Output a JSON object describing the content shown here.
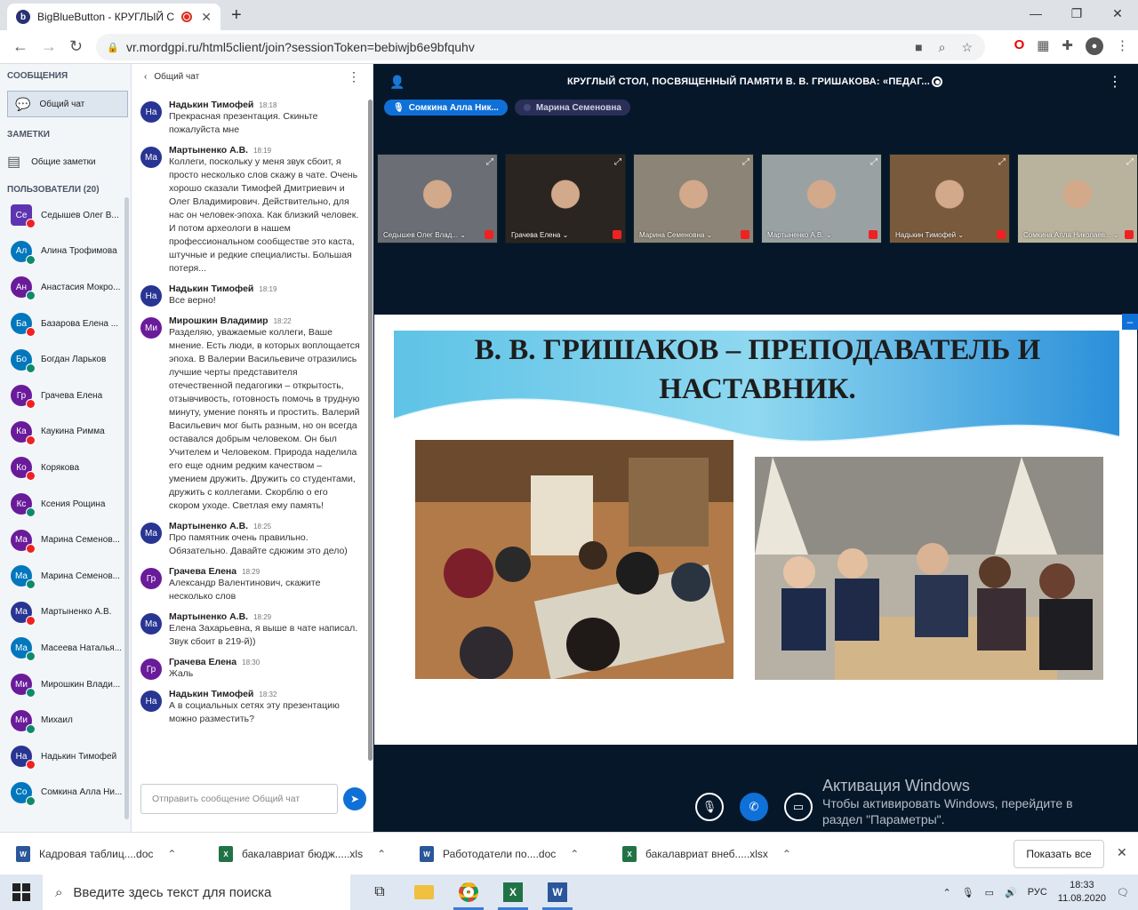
{
  "browser": {
    "tab_title": "BigBlueButton - КРУГЛЫЙ С",
    "tab_favicon": "b",
    "new_tab": "+",
    "url": "vr.mordgpi.ru/html5client/join?sessionToken=bebiwjb6e9bfquhv",
    "window_controls": [
      "—",
      "❐",
      "✕"
    ]
  },
  "user_panel": {
    "messages_heading": "СООБЩЕНИЯ",
    "public_chat": "Общий чат",
    "notes_heading": "ЗАМЕТКИ",
    "shared_notes": "Общие заметки",
    "users_heading": "ПОЛЬЗОВАТЕЛИ (20)",
    "users": [
      {
        "initials": "Се",
        "name": "Седышев Олег В...",
        "color": "#5e35b1",
        "mic": "muted",
        "square": true
      },
      {
        "initials": "Ал",
        "name": "Алина Трофимова",
        "color": "#0277bd",
        "mic": "listen"
      },
      {
        "initials": "Ан",
        "name": "Анастасия Мокро...",
        "color": "#6a1b9a",
        "mic": "listen"
      },
      {
        "initials": "Ба",
        "name": "Базарова Елена ...",
        "color": "#0277bd",
        "mic": "muted"
      },
      {
        "initials": "Бо",
        "name": "Богдан Ларьков",
        "color": "#0277bd",
        "mic": "listen"
      },
      {
        "initials": "Гр",
        "name": "Грачева Елена",
        "color": "#6a1b9a",
        "mic": "muted"
      },
      {
        "initials": "Ка",
        "name": "Каукина Римма",
        "color": "#6a1b9a",
        "mic": "muted"
      },
      {
        "initials": "Ко",
        "name": "Корякова",
        "color": "#6a1b9a",
        "mic": "muted"
      },
      {
        "initials": "Кс",
        "name": "Ксения Рощина",
        "color": "#6a1b9a",
        "mic": "listen"
      },
      {
        "initials": "Ма",
        "name": "Марина Семенов...",
        "color": "#6a1b9a",
        "mic": "muted"
      },
      {
        "initials": "Ма",
        "name": "Марина Семенов...",
        "color": "#0277bd",
        "mic": "listen"
      },
      {
        "initials": "Ма",
        "name": "Мартыненко А.В.",
        "color": "#283593",
        "mic": "muted"
      },
      {
        "initials": "Ма",
        "name": "Масеева Наталья...",
        "color": "#0277bd",
        "mic": "listen"
      },
      {
        "initials": "Ми",
        "name": "Мирошкин Влади...",
        "color": "#6a1b9a",
        "mic": "listen"
      },
      {
        "initials": "Ми",
        "name": "Михаил",
        "color": "#6a1b9a",
        "mic": "listen"
      },
      {
        "initials": "На",
        "name": "Надькин Тимофей",
        "color": "#283593",
        "mic": "muted"
      },
      {
        "initials": "Со",
        "name": "Сомкина Алла Ни...",
        "color": "#0277bd",
        "mic": "listen"
      }
    ]
  },
  "chat": {
    "back_label": "Общий чат",
    "messages": [
      {
        "initials": "На",
        "color": "#283593",
        "name": "Надькин Тимофей",
        "time": "18:18",
        "text": "Прекрасная презентация. Скиньте пожалуйста мне"
      },
      {
        "initials": "Ма",
        "color": "#283593",
        "name": "Мартыненко А.В.",
        "time": "18:19",
        "text": "Коллеги, поскольку у меня звук сбоит, я просто несколько слов скажу в чате. Очень хорошо сказали Тимофей Дмитриевич и Олег Владимирович. Действительно, для нас он человек-эпоха. Как близкий человек. И потом археологи в нашем профессиональном сообществе это каста, штучные и редкие специалисты. Большая потеря..."
      },
      {
        "initials": "На",
        "color": "#283593",
        "name": "Надькин Тимофей",
        "time": "18:19",
        "text": "Все верно!"
      },
      {
        "initials": "Ми",
        "color": "#6a1b9a",
        "name": "Мирошкин Владимир",
        "time": "18:22",
        "text": "Разделяю, уважаемые коллеги, Ваше мнение. Есть люди, в которых воплощается эпоха. В Валерии Васильевиче отразились лучшие черты представителя отечественной педагогики – открытость, отзывчивость, готовность помочь в трудную минуту, умение понять и простить. Валерий Васильевич мог быть разным, но он всегда оставался добрым человеком. Он был Учителем и Человеком. Природа наделила его еще одним редким качеством – умением дружить. Дружить со студентами, дружить с коллегами. Скорблю о его скором уходе. Светлая ему память!"
      },
      {
        "initials": "Ма",
        "color": "#283593",
        "name": "Мартыненко А.В.",
        "time": "18:25",
        "text": "Про памятник очень правильно. Обязательно. Давайте сдюжим это дело)"
      },
      {
        "initials": "Гр",
        "color": "#6a1b9a",
        "name": "Грачева Елена",
        "time": "18:29",
        "text": "Александр Валентинович, скажите несколько слов"
      },
      {
        "initials": "Ма",
        "color": "#283593",
        "name": "Мартыненко А.В.",
        "time": "18:29",
        "text": "Елена Захарьевна, я выше в чате написал. Звук сбоит в 219-й))"
      },
      {
        "initials": "Гр",
        "color": "#6a1b9a",
        "name": "Грачева Елена",
        "time": "18:30",
        "text": "Жаль"
      },
      {
        "initials": "На",
        "color": "#283593",
        "name": "Надькин Тимофей",
        "time": "18:32",
        "text": "А в социальных сетях эту презентацию можно разместить?"
      }
    ],
    "input_placeholder": "Отправить сообщение Общий чат"
  },
  "meeting": {
    "title": "КРУГЛЫЙ СТОЛ, ПОСВЯЩЕННЫЙ ПАМЯТИ В. В. ГРИШАКОВА: «ПЕДАГ...",
    "talking": [
      {
        "name": "Сомкина Алла Ник...",
        "active": true
      },
      {
        "name": "Марина Семеновна",
        "active": false
      }
    ],
    "videos": [
      {
        "name": "Седышев Олег Влад... ⌄",
        "bg": "#6b6e74"
      },
      {
        "name": "Грачева Елена ⌄",
        "bg": "#2a2520"
      },
      {
        "name": "Марина Семеновна ⌄",
        "bg": "#8c8476"
      },
      {
        "name": "Мартыненко А.В. ⌄",
        "bg": "#9aa1a3"
      },
      {
        "name": "Надькин Тимофей ⌄",
        "bg": "#7a5a3c"
      },
      {
        "name": "Сомкина Алла Николаев... ⌄",
        "bg": "#b9b29c"
      }
    ],
    "slide_title": "В. В. ГРИШАКОВ – ПРЕПОДАВАТЕЛЬ И НАСТАВНИК.",
    "activation_title": "Активация Windows",
    "activation_text": "Чтобы активировать Windows, перейдите в раздел \"Параметры\"."
  },
  "downloads": {
    "items": [
      {
        "name": "Кадровая таблиц....doc",
        "type": "W",
        "color": "#2b579a"
      },
      {
        "name": "бакалавриат бюдж.....xls",
        "type": "X",
        "color": "#217346"
      },
      {
        "name": "Работодатели по....doc",
        "type": "W",
        "color": "#2b579a"
      },
      {
        "name": "бакалавриат внеб.....xlsx",
        "type": "X",
        "color": "#217346"
      }
    ],
    "show_all": "Показать все"
  },
  "taskbar": {
    "search_placeholder": "Введите здесь текст для поиска",
    "language": "РУС",
    "time": "18:33",
    "date": "11.08.2020"
  }
}
